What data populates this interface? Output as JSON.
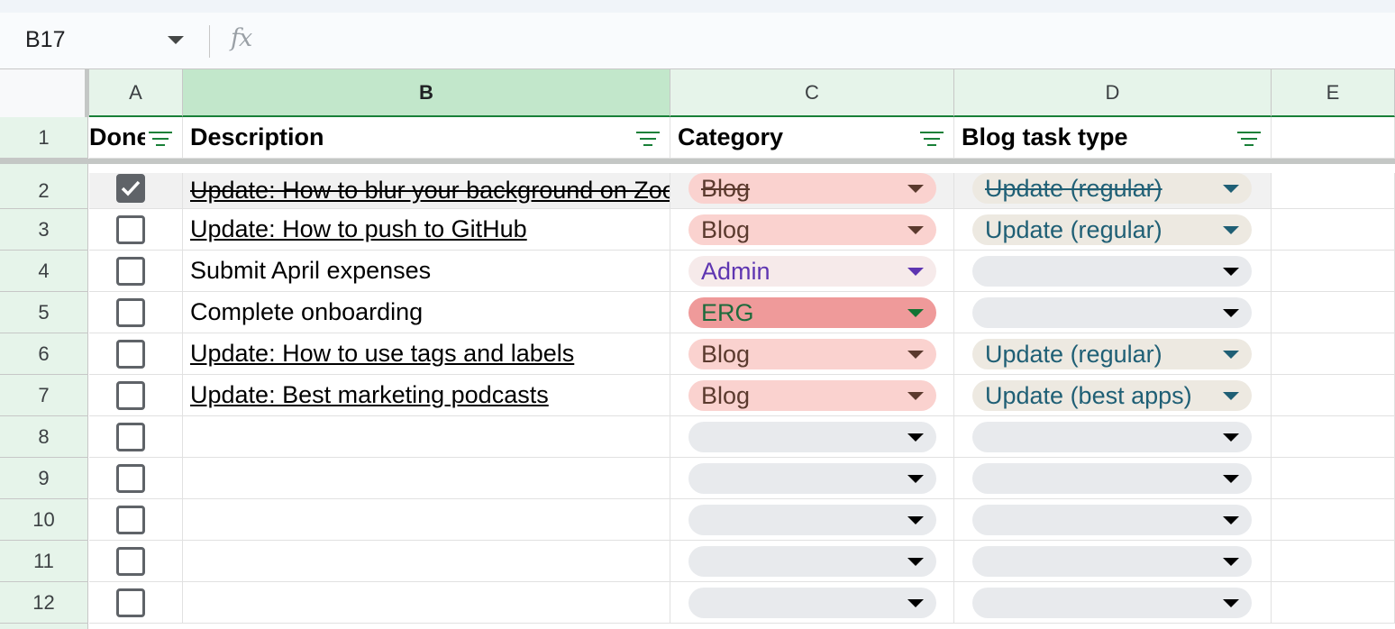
{
  "name_box": {
    "cell_ref": "B17"
  },
  "formula_bar": {
    "fx_label": "fx"
  },
  "columns": [
    "A",
    "B",
    "C",
    "D",
    "E"
  ],
  "rows": [
    "1",
    "2",
    "3",
    "4",
    "5",
    "6",
    "7",
    "8",
    "9",
    "10",
    "11",
    "12"
  ],
  "headers": {
    "done": "Done",
    "description": "Description",
    "category": "Category",
    "blog_task_type": "Blog task type"
  },
  "tasks": [
    {
      "done": true,
      "description": "Update: How to blur your background on Zoom",
      "category": "Blog",
      "blog_task_type": "Update (regular)"
    },
    {
      "done": false,
      "description": "Update: How to push to GitHub",
      "category": "Blog",
      "blog_task_type": "Update (regular)"
    },
    {
      "done": false,
      "description": "Submit April expenses",
      "category": "Admin",
      "blog_task_type": ""
    },
    {
      "done": false,
      "description": "Complete onboarding",
      "category": "ERG",
      "blog_task_type": ""
    },
    {
      "done": false,
      "description": "Update: How to use tags and labels",
      "category": "Blog",
      "blog_task_type": "Update (regular)"
    },
    {
      "done": false,
      "description": "Update: Best marketing podcasts",
      "category": "Blog",
      "blog_task_type": "Update (best apps)"
    }
  ],
  "chip_colors": {
    "Blog": {
      "bg": "#fad2cf",
      "fg": "#5b3a2e",
      "caret": "#5b3a2e"
    },
    "Admin": {
      "bg": "#f6eaea",
      "fg": "#5e35b1",
      "caret": "#5e35b1"
    },
    "ERG": {
      "bg": "#ef9a9a",
      "fg": "#1e6b3c",
      "caret": "#137333"
    },
    "empty": {
      "bg": "#e8eaed",
      "fg": "#000000",
      "caret": "#000000"
    },
    "task_type": {
      "bg": "#ede9e1",
      "fg": "#1f5f75",
      "caret": "#1f5f75"
    }
  },
  "accent_color": "#188038"
}
